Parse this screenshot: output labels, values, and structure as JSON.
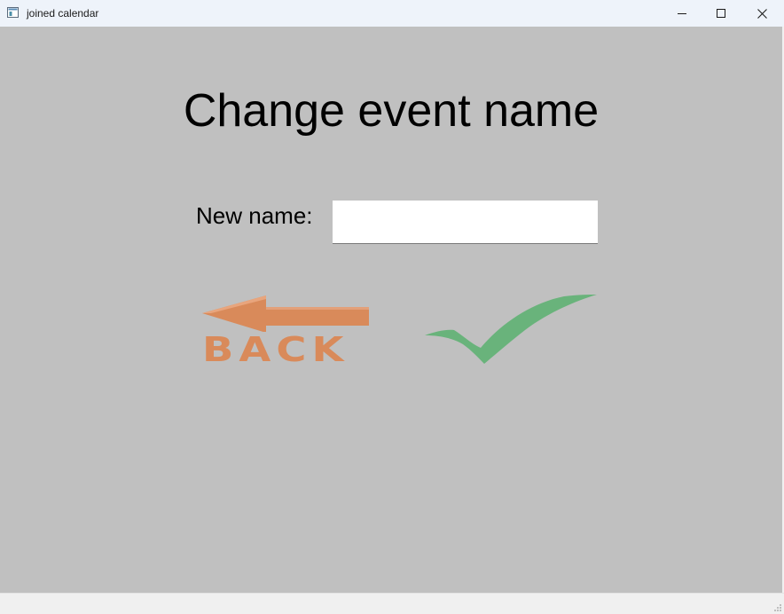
{
  "window": {
    "title": "joined calendar"
  },
  "page": {
    "heading": "Change event name"
  },
  "form": {
    "label": "New name:",
    "input_value": "",
    "input_placeholder": ""
  },
  "actions": {
    "back_label": "BACK",
    "confirm_icon": "checkmark-icon"
  },
  "colors": {
    "background": "#c0c0c0",
    "back_orange": "#d98a5a",
    "check_green": "#69b37b",
    "titlebar": "#eef3fa"
  }
}
